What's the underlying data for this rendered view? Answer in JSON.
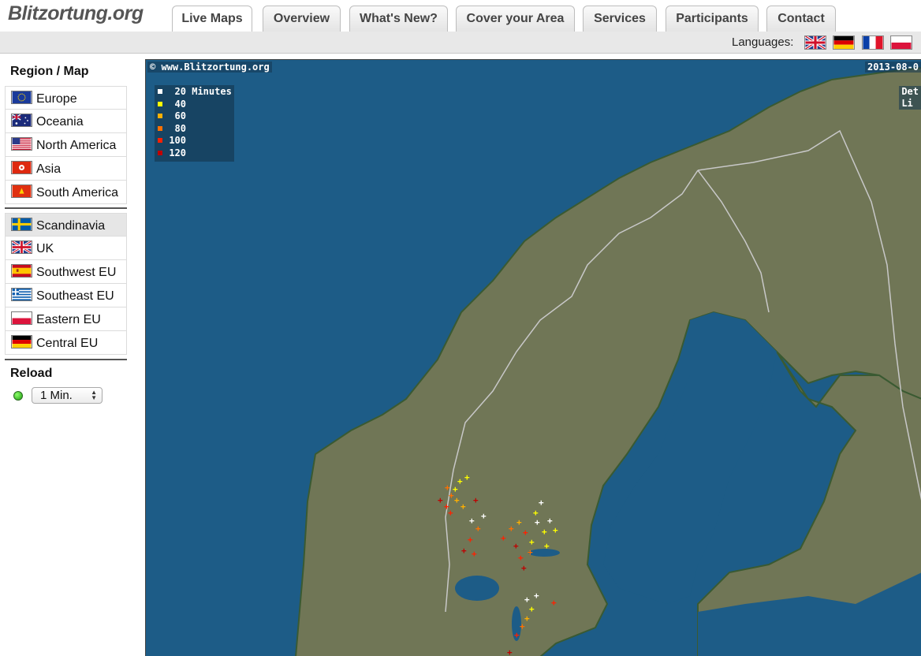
{
  "app": {
    "logo": "Blitzortung.org"
  },
  "nav": {
    "tabs": [
      {
        "label": "Live Maps",
        "active": true
      },
      {
        "label": "Overview",
        "active": false
      },
      {
        "label": "What's New?",
        "active": false
      },
      {
        "label": "Cover your Area",
        "active": false
      },
      {
        "label": "Services",
        "active": false
      },
      {
        "label": "Participants",
        "active": false
      },
      {
        "label": "Contact",
        "active": false
      }
    ]
  },
  "languages": {
    "label": "Languages:",
    "flags": [
      "uk-flag-icon",
      "germany-flag-icon",
      "france-flag-icon",
      "poland-flag-icon"
    ]
  },
  "sidebar": {
    "region_heading": "Region / Map",
    "continents": [
      {
        "label": "Europe",
        "icon": "eu-flag-icon"
      },
      {
        "label": "Oceania",
        "icon": "australia-flag-icon"
      },
      {
        "label": "North America",
        "icon": "usa-flag-icon"
      },
      {
        "label": "Asia",
        "icon": "hongkong-flag-icon"
      },
      {
        "label": "South America",
        "icon": "south-america-flag-icon"
      }
    ],
    "regions": [
      {
        "label": "Scandinavia",
        "icon": "sweden-flag-icon",
        "active": true
      },
      {
        "label": "UK",
        "icon": "uk-flag-icon"
      },
      {
        "label": "Southwest EU",
        "icon": "spain-flag-icon"
      },
      {
        "label": "Southeast EU",
        "icon": "greece-flag-icon"
      },
      {
        "label": "Eastern EU",
        "icon": "poland-flag-icon"
      },
      {
        "label": "Central EU",
        "icon": "germany-flag-icon"
      }
    ],
    "reload_heading": "Reload",
    "reload_value": "1 Min."
  },
  "map": {
    "watermark": "© www.Blitzortung.org",
    "date": "2013-08-0",
    "side_text": [
      "Det",
      "Li"
    ],
    "legend": [
      {
        "value": "20",
        "unit": "Minutes",
        "color": "#ffffff"
      },
      {
        "value": "40",
        "unit": "",
        "color": "#ffff00"
      },
      {
        "value": "60",
        "unit": "",
        "color": "#ffb000"
      },
      {
        "value": "80",
        "unit": "",
        "color": "#ff7000"
      },
      {
        "value": "100",
        "unit": "",
        "color": "#ff2000"
      },
      {
        "value": "120",
        "unit": "",
        "color": "#c00000"
      }
    ],
    "colors": {
      "sea": "#1d5c87",
      "land": "#707656",
      "coast": "#3a5a32",
      "border": "#c8c8c8"
    }
  }
}
